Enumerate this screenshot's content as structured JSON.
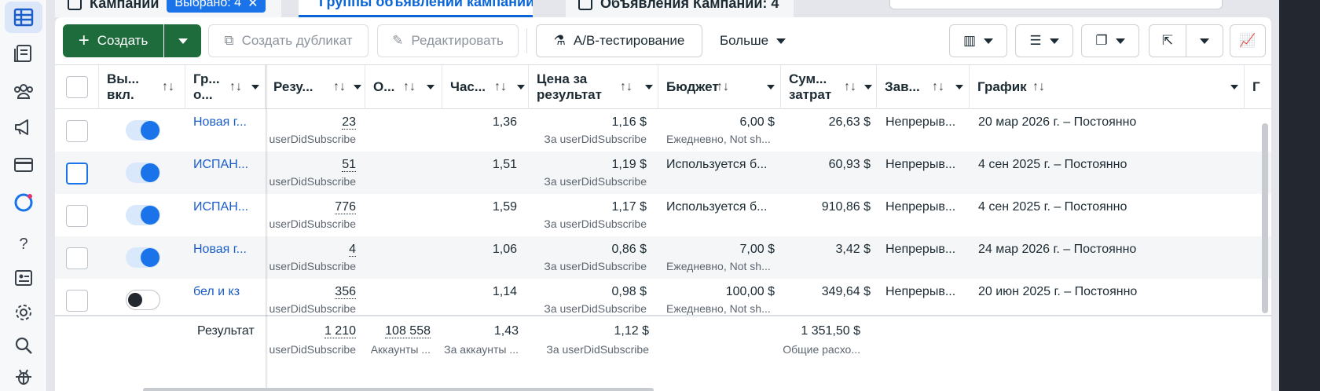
{
  "tabs": {
    "campaigns_label": "Кампании",
    "selected_chip": "Выбрано: 4",
    "adsets_label": "Группы объявлений кампании",
    "ads_label": "Объявления Кампании: 4"
  },
  "toolbar": {
    "create_label": "Создать",
    "duplicate_label": "Создать дубликат",
    "edit_label": "Редактировать",
    "ab_label": "A/B-тестирование",
    "more_label": "Больше"
  },
  "columns": {
    "onoff": "Вы... вкл.",
    "adset": "Гр... о...",
    "results": "Резу...",
    "reach": "О...",
    "freq": "Час...",
    "cpr": "Цена за результат",
    "budget": "Бюджет",
    "spent": "Сум... затрат",
    "ends": "Зав...",
    "schedule": "График",
    "next": "Г"
  },
  "rows": [
    {
      "name": "Новая г...",
      "toggle": "on",
      "results": "23",
      "results_sub": "userDidSubscribe",
      "freq": "1,36",
      "cpr": "1,16 $",
      "cpr_sub": "За userDidSubscribe",
      "budget": "6,00 $",
      "budget_sub": "Ежедневно, Not sh...",
      "spent": "26,63 $",
      "ends": "Непрерыв...",
      "schedule": "20 мар 2026 г. – Постоянно"
    },
    {
      "name": "ИСПАН...",
      "toggle": "on",
      "results": "51",
      "results_sub": "userDidSubscribe",
      "freq": "1,51",
      "cpr": "1,19 $",
      "cpr_sub": "За userDidSubscribe",
      "budget": "Используется б...",
      "budget_sub": "",
      "spent": "60,93 $",
      "ends": "Непрерыв...",
      "schedule": "4 сен 2025 г. – Постоянно"
    },
    {
      "name": "ИСПАН...",
      "toggle": "on",
      "results": "776",
      "results_sub": "userDidSubscribe",
      "freq": "1,59",
      "cpr": "1,17 $",
      "cpr_sub": "За userDidSubscribe",
      "budget": "Используется б...",
      "budget_sub": "",
      "spent": "910,86 $",
      "ends": "Непрерыв...",
      "schedule": "4 сен 2025 г. – Постоянно"
    },
    {
      "name": "Новая г...",
      "toggle": "on",
      "results": "4",
      "results_sub": "userDidSubscribe",
      "freq": "1,06",
      "cpr": "0,86 $",
      "cpr_sub": "За userDidSubscribe",
      "budget": "7,00 $",
      "budget_sub": "Ежедневно, Not sh...",
      "spent": "3,42 $",
      "ends": "Непрерыв...",
      "schedule": "24 мар 2026 г. – Постоянно"
    },
    {
      "name": "бел и кз",
      "toggle": "off",
      "results": "356",
      "results_sub": "userDidSubscribe",
      "freq": "1,14",
      "cpr": "0,98 $",
      "cpr_sub": "За userDidSubscribe",
      "budget": "100,00 $",
      "budget_sub": "Ежедневно, Not sh...",
      "spent": "349,64 $",
      "ends": "Непрерыв...",
      "schedule": "20 июн 2025 г. – Постоянно"
    }
  ],
  "summary": {
    "label": "Результат",
    "results": "1 210",
    "results_sub": "userDidSubscribe",
    "reach": "108 558",
    "reach_sub": "Аккаунты ...",
    "freq": "1,43",
    "freq_sub": "За аккаунты ...",
    "cpr": "1,12 $",
    "cpr_sub": "За userDidSubscribe",
    "spent": "1 351,50 $",
    "spent_sub": "Общие расхо..."
  },
  "sort_glyph": "↑↓"
}
